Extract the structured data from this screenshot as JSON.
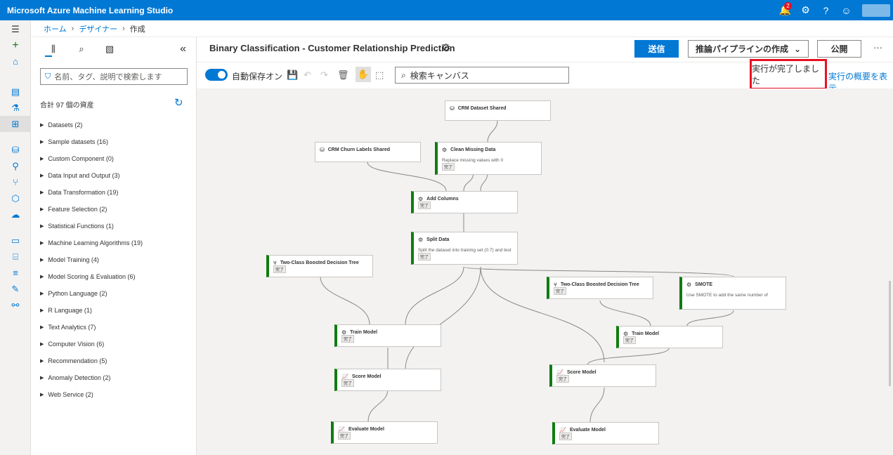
{
  "topbar": {
    "app_title": "Microsoft Azure Machine Learning Studio",
    "notification_count": "2"
  },
  "breadcrumb": {
    "home": "ホーム",
    "designer": "デザイナー",
    "current": "作成"
  },
  "asset_panel": {
    "search_placeholder": "名前、タグ、説明で検索します",
    "asset_count": "合計 97 個の資産",
    "categories": [
      "Datasets (2)",
      "Sample datasets (16)",
      "Custom Component (0)",
      "Data Input and Output (3)",
      "Data Transformation (19)",
      "Feature Selection (2)",
      "Statistical Functions (1)",
      "Machine Learning Algorithms (19)",
      "Model Training (4)",
      "Model Scoring & Evaluation (6)",
      "Python Language (2)",
      "R Language (1)",
      "Text Analytics (7)",
      "Computer Vision (6)",
      "Recommendation (5)",
      "Anomaly Detection (2)",
      "Web Service (2)"
    ]
  },
  "header": {
    "pipeline_title": "Binary Classification - Customer Relationship Prediction",
    "send_label": "送信",
    "inference_label": "推論パイプラインの作成",
    "publish_label": "公開",
    "more_label": "···"
  },
  "toolbar": {
    "autosave_label": "自動保存オン",
    "canvas_search_placeholder": "検索キャンバス",
    "run_status": "実行が完了しました",
    "run_summary_link": "実行の概要を表示"
  },
  "nodes": {
    "crm_dataset": {
      "title": "CRM Dataset Shared"
    },
    "crm_labels": {
      "title": "CRM Churn Labels Shared"
    },
    "clean_missing": {
      "title": "Clean Missing Data",
      "desc": "Replace missing values with 0",
      "status": "完了"
    },
    "add_columns": {
      "title": "Add Columns",
      "status": "完了"
    },
    "split_data": {
      "title": "Split Data",
      "desc": "Split the dataset into training set (0.7) and test",
      "status": "完了"
    },
    "boosted_tree_1": {
      "title": "Two-Class Boosted Decision Tree",
      "status": "完了"
    },
    "boosted_tree_2": {
      "title": "Two-Class Boosted Decision Tree",
      "status": "完了"
    },
    "smote": {
      "title": "SMOTE",
      "desc": "Use SMOTE to add the same number of",
      "status": "完了"
    },
    "train_model_1": {
      "title": "Train Model",
      "status": "完了"
    },
    "train_model_2": {
      "title": "Train Model",
      "status": "完了"
    },
    "score_model_1": {
      "title": "Score Model",
      "status": "完了"
    },
    "score_model_2": {
      "title": "Score Model",
      "status": "完了"
    },
    "evaluate_model_1": {
      "title": "Evaluate Model",
      "status": "完了"
    },
    "evaluate_model_2": {
      "title": "Evaluate Model",
      "status": "完了"
    }
  }
}
